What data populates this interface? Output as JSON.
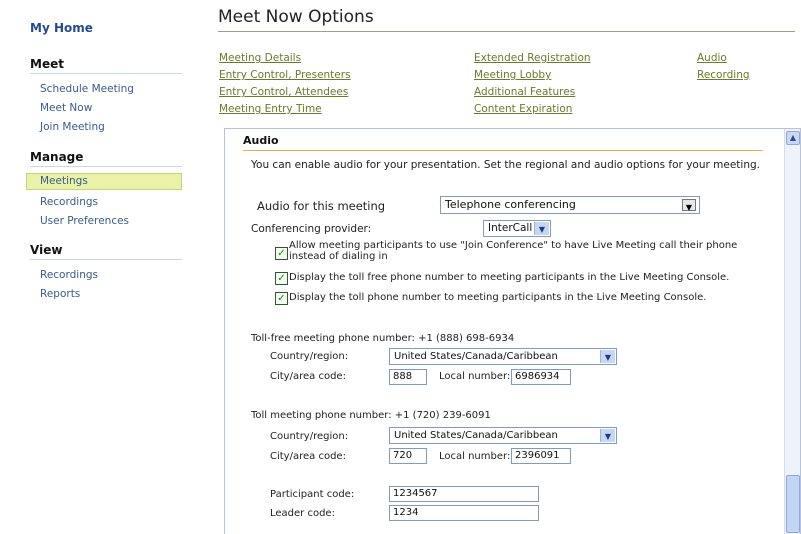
{
  "sidebar": {
    "home": "My Home",
    "meet": {
      "heading": "Meet",
      "items": [
        "Schedule Meeting",
        "Meet Now",
        "Join Meeting"
      ]
    },
    "manage": {
      "heading": "Manage",
      "items": [
        "Meetings",
        "Recordings",
        "User Preferences"
      ],
      "active": "Meetings"
    },
    "view": {
      "heading": "View",
      "items": [
        "Recordings",
        "Reports"
      ]
    }
  },
  "page": {
    "title": "Meet Now Options",
    "links_col1": [
      "Meeting Details",
      "Entry Control, Presenters",
      "Entry Control, Attendees",
      "Meeting Entry Time"
    ],
    "links_col2": [
      "Extended Registration",
      "Meeting Lobby",
      "Additional Features",
      "Content Expiration"
    ],
    "links_col3": [
      "Audio",
      "Recording"
    ]
  },
  "audio": {
    "heading": "Audio",
    "intro": "You can enable audio for your presentation. Set the regional and audio options for your meeting.",
    "audio_label": "Audio for this meeting",
    "audio_value": "Telephone conferencing",
    "provider_label": "Conferencing provider:",
    "provider_value": "InterCall",
    "checkbox1_line1": "Allow meeting participants to use \"Join Conference\" to have Live Meeting call their phone",
    "checkbox1_line2": "instead of dialing in",
    "checkbox2": "Display the toll free phone number to meeting participants in the Live Meeting Console.",
    "checkbox3": "Display the toll phone number to meeting participants in the Live Meeting Console.",
    "tollfree": {
      "title": "Toll-free meeting phone number: +1 (888) 698-6934",
      "country_label": "Country/region:",
      "country_value": "United States/Canada/Caribbean",
      "city_label": "City/area code:",
      "city_value": "888",
      "local_label": "Local number:",
      "local_value": "6986934"
    },
    "toll": {
      "title": "Toll meeting phone number: +1 (720) 239-6091",
      "country_label": "Country/region:",
      "country_value": "United States/Canada/Caribbean",
      "city_label": "City/area code:",
      "city_value": "720",
      "local_label": "Local number:",
      "local_value": "2396091"
    },
    "participant_label": "Participant code:",
    "participant_value": "1234567",
    "leader_label": "Leader code:",
    "leader_value": "1234"
  }
}
